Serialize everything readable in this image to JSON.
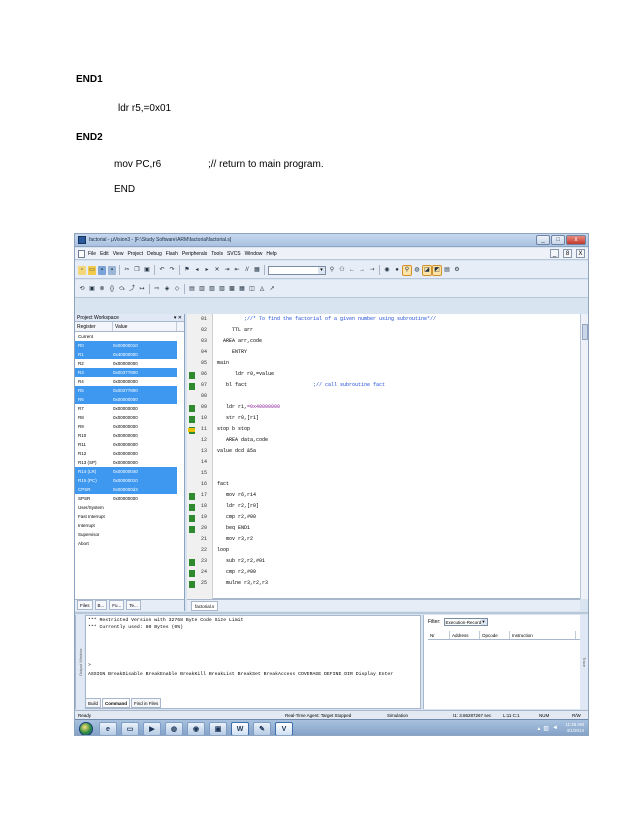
{
  "document": {
    "end1": "END1",
    "ldr_line": "ldr r5,=0x01",
    "end2": "END2",
    "mov_instr": "mov PC,r6",
    "mov_comment": ";// return to main program.",
    "end": "END"
  },
  "window": {
    "title": "factorial - µVision3 - [F:\\Study Software\\ARM\\factorial\\factorial.s]",
    "buttons": [
      "_",
      "□",
      "x"
    ]
  },
  "menu": {
    "items": [
      "File",
      "Edit",
      "View",
      "Project",
      "Debug",
      "Flash",
      "Peripherals",
      "Tools",
      "SVCS",
      "Window",
      "Help"
    ],
    "mdi_buttons": [
      "_",
      "8",
      "X"
    ]
  },
  "project_workspace": {
    "title": "Project Workspace",
    "columns": [
      "Register",
      "Value"
    ],
    "rows": [
      {
        "name": "Current",
        "value": "",
        "selected": false
      },
      {
        "name": "R0",
        "value": "0x00000010",
        "selected": true
      },
      {
        "name": "R1",
        "value": "0x40000000",
        "selected": true
      },
      {
        "name": "R2",
        "value": "0x00000000",
        "selected": false
      },
      {
        "name": "R3",
        "value": "0x00377800",
        "selected": true
      },
      {
        "name": "R4",
        "value": "0x00000000",
        "selected": false
      },
      {
        "name": "R5",
        "value": "0x00377800",
        "selected": true
      },
      {
        "name": "R6",
        "value": "0x00000000",
        "selected": true
      },
      {
        "name": "R7",
        "value": "0x00000000",
        "selected": false
      },
      {
        "name": "R8",
        "value": "0x00000000",
        "selected": false
      },
      {
        "name": "R9",
        "value": "0x00000000",
        "selected": false
      },
      {
        "name": "R10",
        "value": "0x00000000",
        "selected": false
      },
      {
        "name": "R11",
        "value": "0x00000000",
        "selected": false
      },
      {
        "name": "R12",
        "value": "0x00000000",
        "selected": false
      },
      {
        "name": "R13 (SP)",
        "value": "0x00000000",
        "selected": false
      },
      {
        "name": "R14 (LR)",
        "value": "0x00000040",
        "selected": true
      },
      {
        "name": "R15 (PC)",
        "value": "0x00000010",
        "selected": true
      },
      {
        "name": "CPSR",
        "value": "0x000000d3",
        "selected": true
      },
      {
        "name": "SPSR",
        "value": "0x00000000",
        "selected": false
      },
      {
        "name": "User/System",
        "value": "",
        "selected": false
      },
      {
        "name": "Fast Interrupt",
        "value": "",
        "selected": false
      },
      {
        "name": "Interrupt",
        "value": "",
        "selected": false
      },
      {
        "name": "Supervisor",
        "value": "",
        "selected": false
      },
      {
        "name": "Abort",
        "value": "",
        "selected": false
      }
    ],
    "tabs": [
      "Files",
      "B...",
      "Fu...",
      "Te..."
    ]
  },
  "editor": {
    "tab": "factorial.s",
    "lines": [
      {
        "n": "01",
        "code": "         ;//* To find the factorial of a given number using subroutine*//",
        "cls": "cmt",
        "mark": false,
        "arrow": false
      },
      {
        "n": "02",
        "code": "     TTL arr",
        "cls": "",
        "mark": false,
        "arrow": false
      },
      {
        "n": "03",
        "code": "  AREA arr,code",
        "cls": "",
        "mark": false,
        "arrow": false
      },
      {
        "n": "04",
        "code": "     ENTRY",
        "cls": "",
        "mark": false,
        "arrow": false
      },
      {
        "n": "05",
        "code": "main",
        "cls": "",
        "mark": false,
        "arrow": false
      },
      {
        "n": "06",
        "code": "      ldr r0,=value",
        "cls": "",
        "mark": true,
        "arrow": false
      },
      {
        "n": "07",
        "code": "   bl fact                      ;// call subroutine fact",
        "cls": "mix",
        "mark": true,
        "arrow": false
      },
      {
        "n": "08",
        "code": "",
        "cls": "",
        "mark": false,
        "arrow": false
      },
      {
        "n": "09",
        "code": "   ldr r1,=0x40000000",
        "cls": "numx",
        "mark": true,
        "arrow": false
      },
      {
        "n": "10",
        "code": "   str r0,[r1]",
        "cls": "",
        "mark": true,
        "arrow": false
      },
      {
        "n": "11",
        "code": "stop b stop",
        "cls": "",
        "mark": true,
        "arrow": true
      },
      {
        "n": "12",
        "code": "   AREA data,code",
        "cls": "",
        "mark": false,
        "arrow": false
      },
      {
        "n": "13",
        "code": "value dcd &5a",
        "cls": "",
        "mark": false,
        "arrow": false
      },
      {
        "n": "14",
        "code": "",
        "cls": "",
        "mark": false,
        "arrow": false
      },
      {
        "n": "15",
        "code": "",
        "cls": "",
        "mark": false,
        "arrow": false
      },
      {
        "n": "16",
        "code": "fact",
        "cls": "",
        "mark": false,
        "arrow": false
      },
      {
        "n": "17",
        "code": "   mov r6,r14",
        "cls": "",
        "mark": true,
        "arrow": false
      },
      {
        "n": "18",
        "code": "   ldr r2,[r0]",
        "cls": "",
        "mark": true,
        "arrow": false
      },
      {
        "n": "19",
        "code": "   cmp r2,#00",
        "cls": "",
        "mark": true,
        "arrow": false
      },
      {
        "n": "20",
        "code": "   beq END1",
        "cls": "",
        "mark": true,
        "arrow": false
      },
      {
        "n": "21",
        "code": "   mov r3,r2",
        "cls": "",
        "mark": false,
        "arrow": false
      },
      {
        "n": "22",
        "code": "loop",
        "cls": "",
        "mark": false,
        "arrow": false
      },
      {
        "n": "23",
        "code": "   sub r2,r2,#01",
        "cls": "",
        "mark": true,
        "arrow": false
      },
      {
        "n": "24",
        "code": "   cmp r2,#00",
        "cls": "",
        "mark": true,
        "arrow": false
      },
      {
        "n": "25",
        "code": "   mulne r3,r2,r3",
        "cls": "",
        "mark": true,
        "arrow": false
      }
    ]
  },
  "output": {
    "label": "Output Window",
    "lines": [
      "*** Restricted Version with 32768 Byte Code Size Limit",
      "*** Currently used: 80 Bytes (0%)",
      ">",
      "ASSIGN BreakDisable BreakEnable BreakKill BreakList BreakSet BreakAccess COVERAGE DEFINE DIR Display Enter"
    ],
    "tabs": [
      "Build",
      "Command",
      "Find in Files"
    ],
    "active_tab": "Command"
  },
  "trace": {
    "filter_label": "Filter:",
    "filter_value": "Execution-Record",
    "columns": [
      "Nr",
      "Address",
      "Opcode",
      "Instruction"
    ],
    "label": "Trace"
  },
  "statusbar": {
    "ready": "Ready",
    "target": "Real-Time Agent: Target Stopped",
    "mode": "Simulation",
    "time": "t1: 3.86287267 sec",
    "pos": "L:11 C:1",
    "num": "NUM",
    "rw": "R/W"
  },
  "taskbar": {
    "time": "11:26 AM",
    "date": "4/1/2014"
  },
  "colors": {
    "selection": "#3f98ef",
    "comment": "#1f4bd6",
    "breakpoint_green": "#2f8a2f"
  }
}
